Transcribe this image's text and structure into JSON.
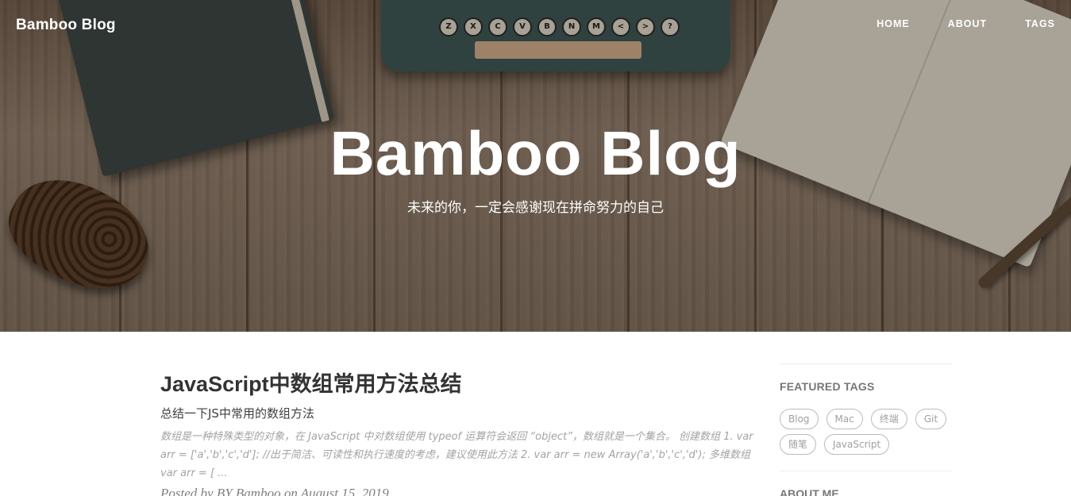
{
  "header": {
    "brand": "Bamboo Blog",
    "nav": [
      "HOME",
      "ABOUT",
      "TAGS"
    ]
  },
  "hero": {
    "title": "Bamboo Blog",
    "subtitle": "未来的你，一定会感谢现在拼命努力的自己",
    "typewriter_keys": [
      "Z",
      "X",
      "C",
      "V",
      "B",
      "N",
      "M",
      "<",
      ">",
      "?"
    ]
  },
  "post": {
    "title": "JavaScript中数组常用方法总结",
    "subtitle": "总结一下JS中常用的数组方法",
    "excerpt": "数组是一种特殊类型的对象，在 JavaScript 中对数组使用 typeof 运算符会返回 “object”，数组就是一个集合。 创建数组 1. var arr = ['a','b','c','d']; //出于简洁、可读性和执行速度的考虑，建议使用此方法 2. var arr = new Array('a','b','c','d'); 多维数组 var arr = [ ...",
    "meta": "Posted by BY Bamboo on August 15, 2019"
  },
  "sidebar": {
    "featured_title": "FEATURED TAGS",
    "tags": [
      "Blog",
      "Mac",
      "终端",
      "Git",
      "随笔",
      "JavaScript"
    ],
    "about_title": "ABOUT ME"
  }
}
